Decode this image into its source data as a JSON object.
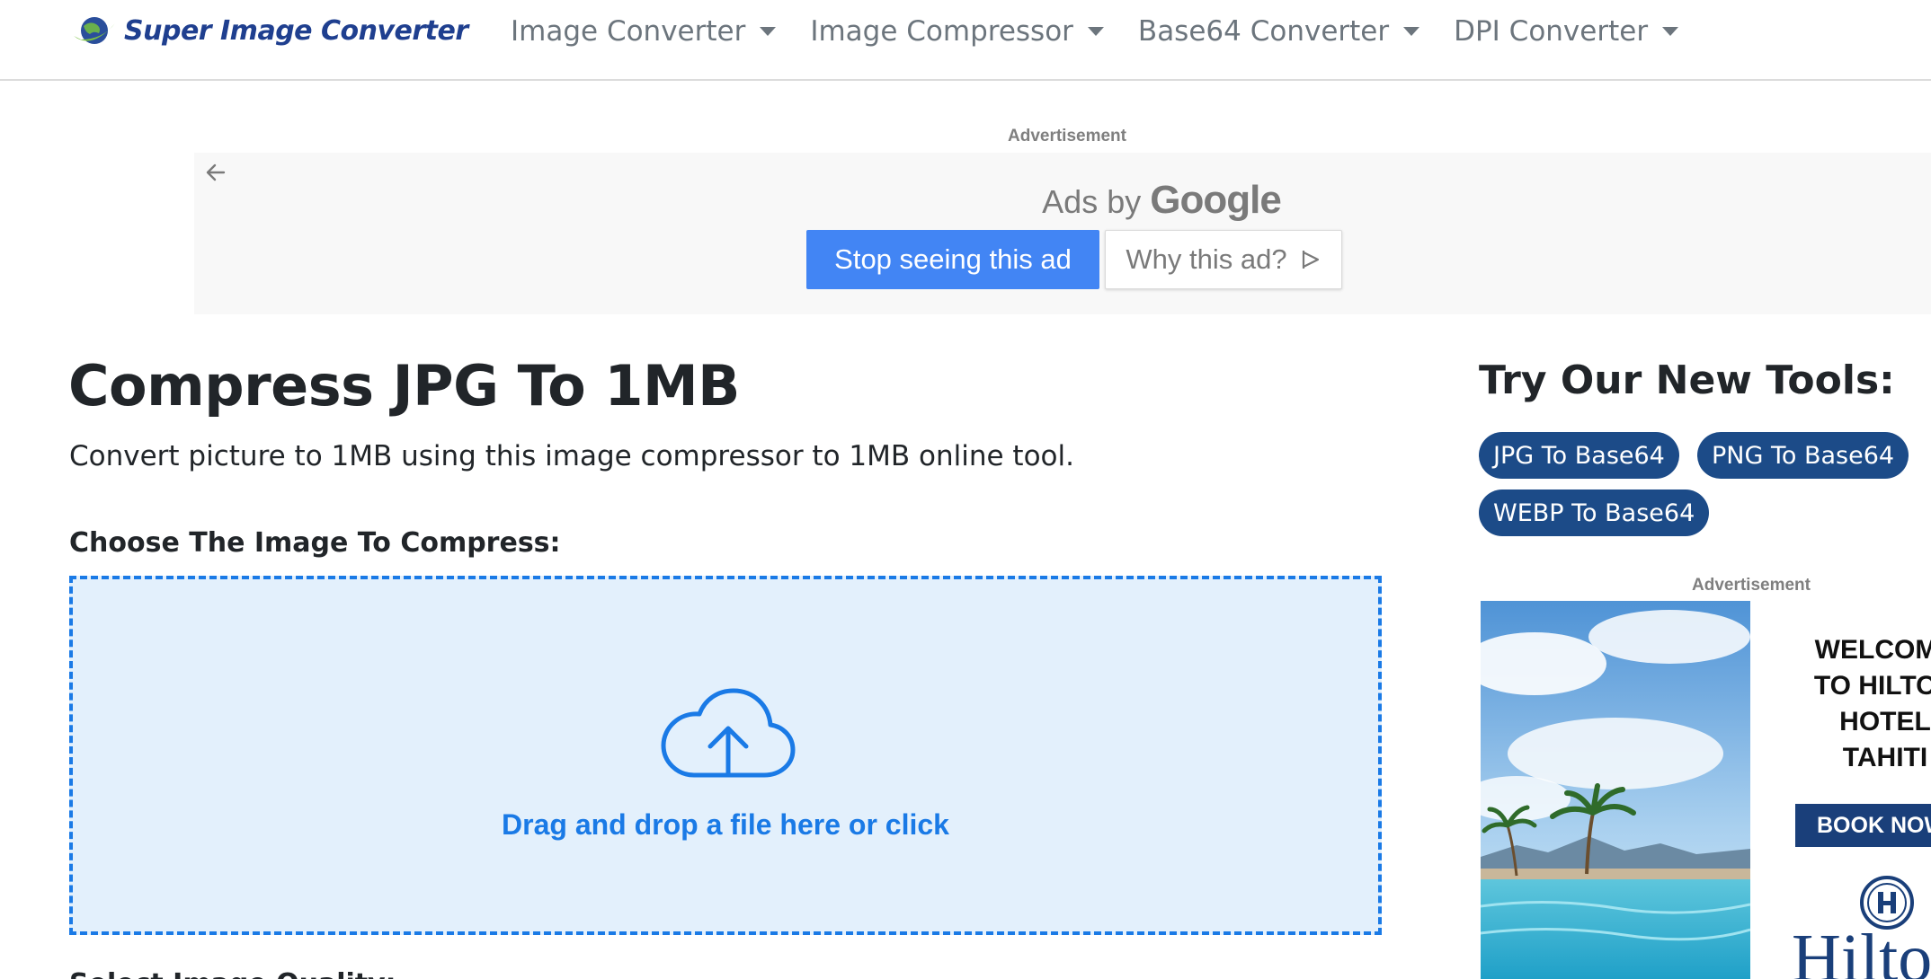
{
  "brand": {
    "name": "Super Image Converter"
  },
  "nav": {
    "items": [
      {
        "label": "Image Converter"
      },
      {
        "label": "Image Compressor"
      },
      {
        "label": "Base64 Converter"
      },
      {
        "label": "DPI Converter"
      }
    ]
  },
  "top_ad": {
    "label": "Advertisement",
    "ads_by": "Ads by",
    "google": "Google",
    "stop_label": "Stop seeing this ad",
    "why_label": "Why this ad?"
  },
  "main": {
    "title": "Compress JPG To 1MB",
    "description": "Convert picture to 1MB using this image compressor to 1MB online tool.",
    "choose_label": "Choose The Image To Compress:",
    "dropzone_text": "Drag and drop a file here or click",
    "next_label": "Select Image Quality:"
  },
  "sidebar": {
    "title": "Try Our New Tools:",
    "tools": [
      {
        "label": "JPG To Base64"
      },
      {
        "label": "PNG To Base64"
      },
      {
        "label": "WEBP To Base64"
      }
    ],
    "ad_label": "Advertisement",
    "ad": {
      "headline": "WELCOME\nTO HILTON\nHOTEL\nTAHITI",
      "cta": "BOOK NOW",
      "brand": "Hilton"
    }
  },
  "colors": {
    "brand_blue": "#1f3f8f",
    "accent_blue": "#1a7ae6",
    "pill_blue": "#1c4b88",
    "dropzone_bg": "#e3f0fc",
    "google_blue": "#4285f4"
  },
  "icons": {
    "brand": "globe-swoosh-icon",
    "dropdown": "caret-down-icon",
    "ad_back": "arrow-left-icon",
    "ad_why": "play-outline-icon",
    "upload": "cloud-upload-icon"
  }
}
